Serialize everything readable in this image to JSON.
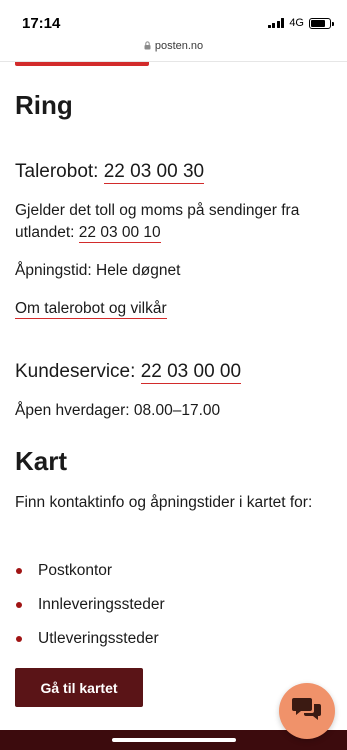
{
  "status_bar": {
    "time": "17:14",
    "network": "4G"
  },
  "browser": {
    "url": "posten.no"
  },
  "ring": {
    "heading": "Ring",
    "talerobot_label": "Talerobot: ",
    "talerobot_number": "22 03 00 30",
    "toll_text": "Gjelder det toll og moms på sendinger fra utlandet: ",
    "toll_number": "22 03 00 10",
    "hours": "Åpningstid: Hele døgnet",
    "terms_link": "Om talerobot og vilkår",
    "customer_label": "Kundeservice: ",
    "customer_number": "22 03 00 00",
    "customer_hours": "Åpen hverdager: 08.00–17.00"
  },
  "kart": {
    "heading": "Kart",
    "intro": "Finn kontaktinfo og åpningstider i kartet for:",
    "items": [
      "Postkontor",
      "Innleveringssteder",
      "Utleveringssteder"
    ],
    "button": "Gå til kartet"
  },
  "colors": {
    "accent_red": "#d22b2b",
    "button_bg": "#5a1417",
    "footer_bg": "#3c0b0d",
    "chat_bg": "#f0926a"
  },
  "icons": {
    "chat": "chat-icon",
    "lock": "lock-icon"
  }
}
